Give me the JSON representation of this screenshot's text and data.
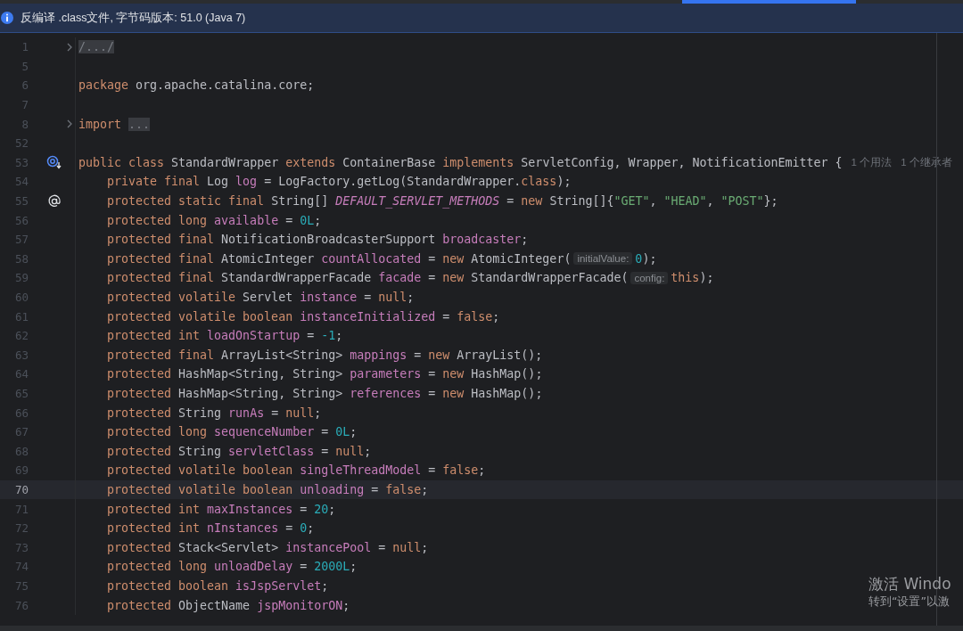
{
  "top_bar": {
    "active_tab_indicator": true
  },
  "banner": {
    "text": "反编译 .class文件, 字节码版本: 51.0 (Java 7)"
  },
  "editor": {
    "lines": [
      {
        "number": "1",
        "current": false,
        "folded": true,
        "tokens": [
          {
            "kind": "folded",
            "text": "/.../"
          }
        ]
      },
      {
        "number": "5",
        "current": false,
        "folded": false
      },
      {
        "number": "6",
        "current": false,
        "folded": false,
        "tokens": [
          {
            "kind": "keyword",
            "text": "package "
          },
          {
            "kind": "plain",
            "text": "org.apache.catalina.core;"
          }
        ]
      },
      {
        "number": "7",
        "current": false,
        "folded": false
      },
      {
        "number": "8",
        "current": false,
        "folded": true,
        "tokens": [
          {
            "kind": "keyword",
            "text": "import "
          },
          {
            "kind": "folded",
            "text": "..."
          }
        ]
      },
      {
        "number": "52",
        "current": false,
        "folded": false
      },
      {
        "number": "53",
        "current": false,
        "folded": false,
        "gutter_marker": {
          "kind": "inherited"
        },
        "tokens": [
          {
            "kind": "keyword",
            "text": "public class "
          },
          {
            "kind": "plain",
            "text": "StandardWrapper "
          },
          {
            "kind": "keyword",
            "text": "extends "
          },
          {
            "kind": "plain",
            "text": "ContainerBase "
          },
          {
            "kind": "keyword",
            "text": "implements "
          },
          {
            "kind": "plain",
            "text": "ServletConfig, Wrapper, NotificationEmitter {"
          },
          {
            "kind": "usage",
            "text": "1 个用法"
          },
          {
            "kind": "usage",
            "text": "1 个继承者"
          }
        ],
        "children": [
          {
            "number": "54",
            "current": false,
            "folded": false,
            "tokens": [
              {
                "kind": "keyword",
                "text": "private final "
              },
              {
                "kind": "plain",
                "text": "Log "
              },
              {
                "kind": "field",
                "text": "log"
              },
              {
                "kind": "plain",
                "text": " = LogFactory.getLog(StandardWrapper."
              },
              {
                "kind": "keyword",
                "text": "class"
              },
              {
                "kind": "plain",
                "text": ");"
              }
            ]
          },
          {
            "number": "55",
            "current": false,
            "folded": false,
            "gutter_marker": {
              "kind": "annotation"
            },
            "tokens": [
              {
                "kind": "keyword",
                "text": "protected static final "
              },
              {
                "kind": "plain",
                "text": "String[] "
              },
              {
                "kind": "static",
                "text": "DEFAULT_SERVLET_METHODS"
              },
              {
                "kind": "plain",
                "text": " = "
              },
              {
                "kind": "keyword",
                "text": "new "
              },
              {
                "kind": "plain",
                "text": "String[]{"
              },
              {
                "kind": "string",
                "text": "\"GET\""
              },
              {
                "kind": "plain",
                "text": ", "
              },
              {
                "kind": "string",
                "text": "\"HEAD\""
              },
              {
                "kind": "plain",
                "text": ", "
              },
              {
                "kind": "string",
                "text": "\"POST\""
              },
              {
                "kind": "plain",
                "text": "};"
              }
            ]
          },
          {
            "number": "56",
            "current": false,
            "folded": false,
            "tokens": [
              {
                "kind": "keyword",
                "text": "protected long "
              },
              {
                "kind": "field",
                "text": "available"
              },
              {
                "kind": "plain",
                "text": " = "
              },
              {
                "kind": "number",
                "text": "0L"
              },
              {
                "kind": "plain",
                "text": ";"
              }
            ]
          },
          {
            "number": "57",
            "current": false,
            "folded": false,
            "tokens": [
              {
                "kind": "keyword",
                "text": "protected final "
              },
              {
                "kind": "plain",
                "text": "NotificationBroadcasterSupport "
              },
              {
                "kind": "field",
                "text": "broadcaster"
              },
              {
                "kind": "plain",
                "text": ";"
              }
            ]
          },
          {
            "number": "58",
            "current": false,
            "folded": false,
            "tokens": [
              {
                "kind": "keyword",
                "text": "protected final "
              },
              {
                "kind": "plain",
                "text": "AtomicInteger "
              },
              {
                "kind": "field",
                "text": "countAllocated"
              },
              {
                "kind": "plain",
                "text": " = "
              },
              {
                "kind": "keyword",
                "text": "new "
              },
              {
                "kind": "plain",
                "text": "AtomicInteger("
              },
              {
                "kind": "hint",
                "text": "initialValue:"
              },
              {
                "kind": "number",
                "text": "0"
              },
              {
                "kind": "plain",
                "text": ");"
              }
            ]
          },
          {
            "number": "59",
            "current": false,
            "folded": false,
            "tokens": [
              {
                "kind": "keyword",
                "text": "protected final "
              },
              {
                "kind": "plain",
                "text": "StandardWrapperFacade "
              },
              {
                "kind": "field",
                "text": "facade"
              },
              {
                "kind": "plain",
                "text": " = "
              },
              {
                "kind": "keyword",
                "text": "new "
              },
              {
                "kind": "plain",
                "text": "StandardWrapperFacade("
              },
              {
                "kind": "hint",
                "text": "config:"
              },
              {
                "kind": "keyword",
                "text": "this"
              },
              {
                "kind": "plain",
                "text": ");"
              }
            ]
          },
          {
            "number": "60",
            "current": false,
            "folded": false,
            "tokens": [
              {
                "kind": "keyword",
                "text": "protected volatile "
              },
              {
                "kind": "plain",
                "text": "Servlet "
              },
              {
                "kind": "field",
                "text": "instance"
              },
              {
                "kind": "plain",
                "text": " = "
              },
              {
                "kind": "keyword",
                "text": "null"
              },
              {
                "kind": "plain",
                "text": ";"
              }
            ]
          },
          {
            "number": "61",
            "current": false,
            "folded": false,
            "tokens": [
              {
                "kind": "keyword",
                "text": "protected volatile boolean "
              },
              {
                "kind": "field",
                "text": "instanceInitialized"
              },
              {
                "kind": "plain",
                "text": " = "
              },
              {
                "kind": "keyword",
                "text": "false"
              },
              {
                "kind": "plain",
                "text": ";"
              }
            ]
          },
          {
            "number": "62",
            "current": false,
            "folded": false,
            "tokens": [
              {
                "kind": "keyword",
                "text": "protected int "
              },
              {
                "kind": "field",
                "text": "loadOnStartup"
              },
              {
                "kind": "plain",
                "text": " = "
              },
              {
                "kind": "number",
                "text": "-1"
              },
              {
                "kind": "plain",
                "text": ";"
              }
            ]
          },
          {
            "number": "63",
            "current": false,
            "folded": false,
            "tokens": [
              {
                "kind": "keyword",
                "text": "protected final "
              },
              {
                "kind": "plain",
                "text": "ArrayList<String> "
              },
              {
                "kind": "field",
                "text": "mappings"
              },
              {
                "kind": "plain",
                "text": " = "
              },
              {
                "kind": "keyword",
                "text": "new "
              },
              {
                "kind": "plain",
                "text": "ArrayList();"
              }
            ]
          },
          {
            "number": "64",
            "current": false,
            "folded": false,
            "tokens": [
              {
                "kind": "keyword",
                "text": "protected "
              },
              {
                "kind": "plain",
                "text": "HashMap<String, String> "
              },
              {
                "kind": "field",
                "text": "parameters"
              },
              {
                "kind": "plain",
                "text": " = "
              },
              {
                "kind": "keyword",
                "text": "new "
              },
              {
                "kind": "plain",
                "text": "HashMap();"
              }
            ]
          },
          {
            "number": "65",
            "current": false,
            "folded": false,
            "tokens": [
              {
                "kind": "keyword",
                "text": "protected "
              },
              {
                "kind": "plain",
                "text": "HashMap<String, String> "
              },
              {
                "kind": "field",
                "text": "references"
              },
              {
                "kind": "plain",
                "text": " = "
              },
              {
                "kind": "keyword",
                "text": "new "
              },
              {
                "kind": "plain",
                "text": "HashMap();"
              }
            ]
          },
          {
            "number": "66",
            "current": false,
            "folded": false,
            "tokens": [
              {
                "kind": "keyword",
                "text": "protected "
              },
              {
                "kind": "plain",
                "text": "String "
              },
              {
                "kind": "field",
                "text": "runAs"
              },
              {
                "kind": "plain",
                "text": " = "
              },
              {
                "kind": "keyword",
                "text": "null"
              },
              {
                "kind": "plain",
                "text": ";"
              }
            ]
          },
          {
            "number": "67",
            "current": false,
            "folded": false,
            "tokens": [
              {
                "kind": "keyword",
                "text": "protected long "
              },
              {
                "kind": "field",
                "text": "sequenceNumber"
              },
              {
                "kind": "plain",
                "text": " = "
              },
              {
                "kind": "number",
                "text": "0L"
              },
              {
                "kind": "plain",
                "text": ";"
              }
            ]
          },
          {
            "number": "68",
            "current": false,
            "folded": false,
            "tokens": [
              {
                "kind": "keyword",
                "text": "protected "
              },
              {
                "kind": "plain",
                "text": "String "
              },
              {
                "kind": "field",
                "text": "servletClass"
              },
              {
                "kind": "plain",
                "text": " = "
              },
              {
                "kind": "keyword",
                "text": "null"
              },
              {
                "kind": "plain",
                "text": ";"
              }
            ]
          },
          {
            "number": "69",
            "current": false,
            "folded": false,
            "tokens": [
              {
                "kind": "keyword",
                "text": "protected volatile boolean "
              },
              {
                "kind": "field",
                "text": "singleThreadModel"
              },
              {
                "kind": "plain",
                "text": " = "
              },
              {
                "kind": "keyword",
                "text": "false"
              },
              {
                "kind": "plain",
                "text": ";"
              }
            ]
          },
          {
            "number": "70",
            "current": true,
            "folded": false,
            "tokens": [
              {
                "kind": "keyword",
                "text": "protected volatile boolean "
              },
              {
                "kind": "field",
                "text": "unloading"
              },
              {
                "kind": "plain",
                "text": " = "
              },
              {
                "kind": "keyword",
                "text": "false"
              },
              {
                "kind": "plain",
                "text": ";"
              }
            ]
          },
          {
            "number": "71",
            "current": false,
            "folded": false,
            "tokens": [
              {
                "kind": "keyword",
                "text": "protected int "
              },
              {
                "kind": "field",
                "text": "maxInstances"
              },
              {
                "kind": "plain",
                "text": " = "
              },
              {
                "kind": "number",
                "text": "20"
              },
              {
                "kind": "plain",
                "text": ";"
              }
            ]
          },
          {
            "number": "72",
            "current": false,
            "folded": false,
            "tokens": [
              {
                "kind": "keyword",
                "text": "protected int "
              },
              {
                "kind": "field",
                "text": "nInstances"
              },
              {
                "kind": "plain",
                "text": " = "
              },
              {
                "kind": "number",
                "text": "0"
              },
              {
                "kind": "plain",
                "text": ";"
              }
            ]
          },
          {
            "number": "73",
            "current": false,
            "folded": false,
            "tokens": [
              {
                "kind": "keyword",
                "text": "protected "
              },
              {
                "kind": "plain",
                "text": "Stack<Servlet> "
              },
              {
                "kind": "field",
                "text": "instancePool"
              },
              {
                "kind": "plain",
                "text": " = "
              },
              {
                "kind": "keyword",
                "text": "null"
              },
              {
                "kind": "plain",
                "text": ";"
              }
            ]
          },
          {
            "number": "74",
            "current": false,
            "folded": false,
            "tokens": [
              {
                "kind": "keyword",
                "text": "protected long "
              },
              {
                "kind": "field",
                "text": "unloadDelay"
              },
              {
                "kind": "plain",
                "text": " = "
              },
              {
                "kind": "number",
                "text": "2000L"
              },
              {
                "kind": "plain",
                "text": ";"
              }
            ]
          },
          {
            "number": "75",
            "current": false,
            "folded": false,
            "tokens": [
              {
                "kind": "keyword",
                "text": "protected boolean "
              },
              {
                "kind": "field",
                "text": "isJspServlet"
              },
              {
                "kind": "plain",
                "text": ";"
              }
            ]
          },
          {
            "number": "76",
            "current": false,
            "folded": false,
            "tokens": [
              {
                "kind": "keyword",
                "text": "protected "
              },
              {
                "kind": "plain",
                "text": "ObjectName "
              },
              {
                "kind": "field",
                "text": "jspMonitorON"
              },
              {
                "kind": "plain",
                "text": ";"
              }
            ]
          }
        ]
      }
    ]
  },
  "activation_notice": {
    "title": "激活 Windo",
    "subtitle": "转到“设置”以激"
  }
}
